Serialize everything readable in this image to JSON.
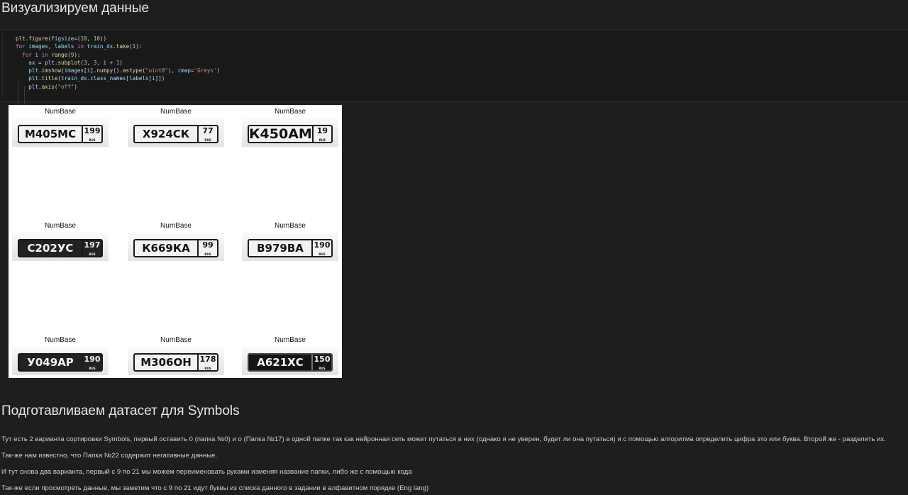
{
  "heading_visualize": "Визуализируем данные",
  "code_lines": [
    [
      [
        "fn",
        "plt.figure"
      ],
      [
        "pl",
        "("
      ],
      [
        "var",
        "figsize"
      ],
      [
        "pl",
        "=("
      ],
      [
        "num",
        "10"
      ],
      [
        "pl",
        ", "
      ],
      [
        "num",
        "10"
      ],
      [
        "pl",
        "))"
      ]
    ],
    [
      [
        "kw",
        "for"
      ],
      [
        "pl",
        " "
      ],
      [
        "var",
        "images"
      ],
      [
        "pl",
        ", "
      ],
      [
        "var",
        "labels"
      ],
      [
        "pl",
        " "
      ],
      [
        "kw",
        "in"
      ],
      [
        "pl",
        " "
      ],
      [
        "var",
        "train_ds"
      ],
      [
        "pl",
        "."
      ],
      [
        "fn",
        "take"
      ],
      [
        "pl",
        "("
      ],
      [
        "num",
        "1"
      ],
      [
        "pl",
        "):"
      ]
    ],
    [
      [
        "pl",
        "  "
      ],
      [
        "kw",
        "for"
      ],
      [
        "pl",
        " "
      ],
      [
        "var",
        "i"
      ],
      [
        "pl",
        " "
      ],
      [
        "kw",
        "in"
      ],
      [
        "pl",
        " "
      ],
      [
        "fn",
        "range"
      ],
      [
        "pl",
        "("
      ],
      [
        "num",
        "9"
      ],
      [
        "pl",
        "):"
      ]
    ],
    [
      [
        "pl",
        "    "
      ],
      [
        "var",
        "ax"
      ],
      [
        "pl",
        " = "
      ],
      [
        "var",
        "plt"
      ],
      [
        "pl",
        "."
      ],
      [
        "fn",
        "subplot"
      ],
      [
        "pl",
        "("
      ],
      [
        "num",
        "3"
      ],
      [
        "pl",
        ", "
      ],
      [
        "num",
        "3"
      ],
      [
        "pl",
        ", "
      ],
      [
        "var",
        "i"
      ],
      [
        "pl",
        " + "
      ],
      [
        "num",
        "1"
      ],
      [
        "pl",
        ")"
      ]
    ],
    [
      [
        "pl",
        "    "
      ],
      [
        "var",
        "plt"
      ],
      [
        "pl",
        "."
      ],
      [
        "fn",
        "imshow"
      ],
      [
        "pl",
        "("
      ],
      [
        "var",
        "images"
      ],
      [
        "pl",
        "["
      ],
      [
        "var",
        "i"
      ],
      [
        "pl",
        "]."
      ],
      [
        "fn",
        "numpy"
      ],
      [
        "pl",
        "()."
      ],
      [
        "fn",
        "astype"
      ],
      [
        "pl",
        "("
      ],
      [
        "str",
        "\"uint8\""
      ],
      [
        "pl",
        "), "
      ],
      [
        "var",
        "cmap"
      ],
      [
        "pl",
        "="
      ],
      [
        "str",
        "'Greys'"
      ],
      [
        "pl",
        ")"
      ]
    ],
    [
      [
        "pl",
        "    "
      ],
      [
        "var",
        "plt"
      ],
      [
        "pl",
        "."
      ],
      [
        "fn",
        "title"
      ],
      [
        "pl",
        "("
      ],
      [
        "var",
        "train_ds"
      ],
      [
        "pl",
        "."
      ],
      [
        "var",
        "class_names"
      ],
      [
        "pl",
        "["
      ],
      [
        "var",
        "labels"
      ],
      [
        "pl",
        "["
      ],
      [
        "var",
        "i"
      ],
      [
        "pl",
        "]])"
      ]
    ],
    [
      [
        "pl",
        "    "
      ],
      [
        "var",
        "plt"
      ],
      [
        "pl",
        "."
      ],
      [
        "fn",
        "axis"
      ],
      [
        "pl",
        "("
      ],
      [
        "str",
        "\"off\""
      ],
      [
        "pl",
        ")"
      ]
    ]
  ],
  "subplots": [
    {
      "title": "NumBase",
      "plate": "М405МС",
      "region": "199",
      "style": ""
    },
    {
      "title": "NumBase",
      "plate": "Х924СК",
      "region": "77",
      "style": ""
    },
    {
      "title": "NumBase",
      "plate": "К450АМ",
      "region": "19",
      "style": "big"
    },
    {
      "title": "NumBase",
      "plate": "С202УС",
      "region": "197",
      "style": "inverted"
    },
    {
      "title": "NumBase",
      "plate": "К669КА",
      "region": "99",
      "style": ""
    },
    {
      "title": "NumBase",
      "plate": "В979ВА",
      "region": "190",
      "style": ""
    },
    {
      "title": "NumBase",
      "plate": "У049АР",
      "region": "190",
      "style": "inverted"
    },
    {
      "title": "NumBase",
      "plate": "М306ОН",
      "region": "178",
      "style": ""
    },
    {
      "title": "NumBase",
      "plate": "А621ХС",
      "region": "150",
      "style": "dark"
    }
  ],
  "heading_symbols": "Подготавливаем датасет для Symbols",
  "paragraphs": [
    "Тут есть 2 варианта сортировки Symbols, первый оставить 0 (папка №0) и о (Папка №17) в одной папке так как нейронная сеть может путаться в них (однако я не уверен, будет ли она путаться) и с помощью алгоритма определить цифра это или буква. Второй же - разделить их.",
    "Так-же нам известно, что Папка №22 содержит негативные данные.",
    "И тут снова два варианта, первый с 9 по 21 мы можем переименовать руками изменяя название папки, либо же с помощью кода",
    "Так-же если просмотреть данные, мы заметим что с 9 по 21 идут буквы из списка данного в задании в алфавитном порядке (Eng lang)"
  ],
  "rus_label": "RUS"
}
